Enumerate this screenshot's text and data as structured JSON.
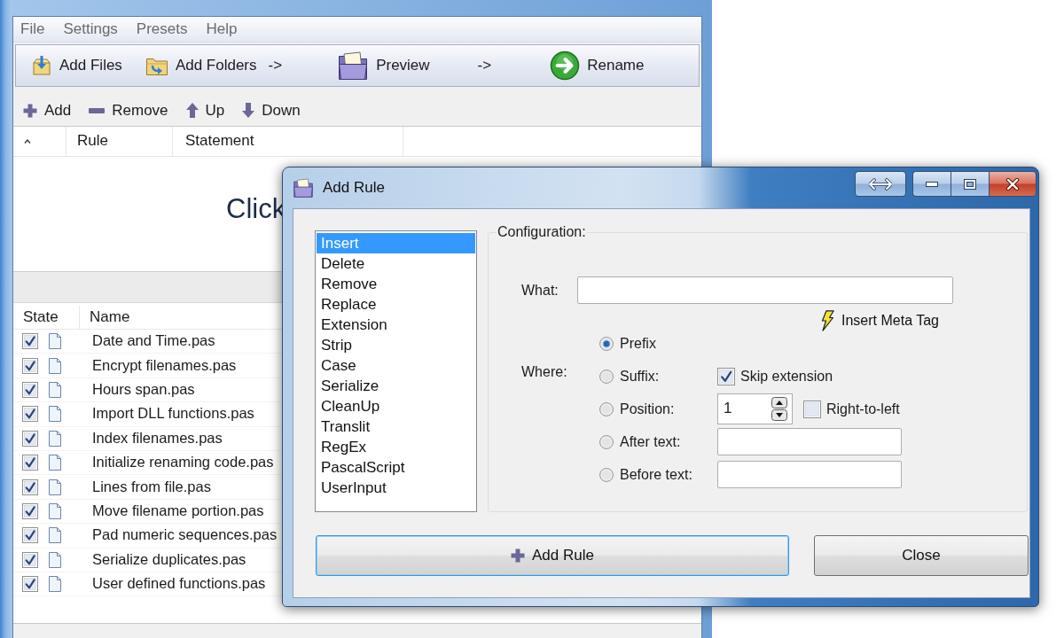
{
  "main_window": {
    "menu": [
      {
        "label": "File"
      },
      {
        "label": "Settings"
      },
      {
        "label": "Presets"
      },
      {
        "label": "Help"
      }
    ],
    "toolbar": [
      {
        "kind": "button",
        "label": "Add Files"
      },
      {
        "kind": "button",
        "label": "Add Folders"
      },
      {
        "kind": "arrow",
        "label": "->"
      },
      {
        "kind": "button",
        "label": "Preview"
      },
      {
        "kind": "arrow",
        "label": "->"
      },
      {
        "kind": "button",
        "label": "Rename"
      }
    ],
    "rules_toolbar": [
      {
        "label": "Add"
      },
      {
        "label": "Remove"
      },
      {
        "label": "Up"
      },
      {
        "label": "Down"
      }
    ],
    "rules_table": {
      "columns": [
        "Rule",
        "Statement"
      ],
      "hint": "Click"
    },
    "files_table": {
      "columns": [
        "State",
        "Name"
      ],
      "rows": [
        {
          "checked": true,
          "name": "Date and Time.pas"
        },
        {
          "checked": true,
          "name": "Encrypt filenames.pas"
        },
        {
          "checked": true,
          "name": "Hours span.pas"
        },
        {
          "checked": true,
          "name": "Import DLL functions.pas"
        },
        {
          "checked": true,
          "name": "Index filenames.pas"
        },
        {
          "checked": true,
          "name": "Initialize renaming code.pas"
        },
        {
          "checked": true,
          "name": "Lines from file.pas"
        },
        {
          "checked": true,
          "name": "Move filename portion.pas"
        },
        {
          "checked": true,
          "name": "Pad numeric sequences.pas"
        },
        {
          "checked": true,
          "name": "Serialize duplicates.pas"
        },
        {
          "checked": true,
          "name": "User defined functions.pas"
        }
      ]
    }
  },
  "dialog": {
    "title": "Add Rule",
    "rule_types": [
      {
        "label": "Insert",
        "selected": true
      },
      {
        "label": "Delete",
        "selected": false
      },
      {
        "label": "Remove",
        "selected": false
      },
      {
        "label": "Replace",
        "selected": false
      },
      {
        "label": "Extension",
        "selected": false
      },
      {
        "label": "Strip",
        "selected": false
      },
      {
        "label": "Case",
        "selected": false
      },
      {
        "label": "Serialize",
        "selected": false
      },
      {
        "label": "CleanUp",
        "selected": false
      },
      {
        "label": "Translit",
        "selected": false
      },
      {
        "label": "RegEx",
        "selected": false
      },
      {
        "label": "PascalScript",
        "selected": false
      },
      {
        "label": "UserInput",
        "selected": false
      }
    ],
    "configuration": {
      "title": "Configuration:",
      "what": {
        "label": "What:"
      },
      "meta_tag_link": "Insert Meta Tag",
      "where": {
        "label": "Where:",
        "options": [
          {
            "label": "Prefix",
            "selected": true
          },
          {
            "label": "Suffix:",
            "selected": false,
            "controls": [
              {
                "kind": "checkbox",
                "label": "Skip extension",
                "checked": true
              }
            ]
          },
          {
            "label": "Position:",
            "selected": false,
            "controls": [
              {
                "kind": "spin",
                "value": "1"
              },
              {
                "kind": "checkbox",
                "label": "Right-to-left",
                "checked": false
              }
            ]
          },
          {
            "label": "After text:",
            "selected": false,
            "controls": [
              {
                "kind": "text_field"
              }
            ]
          },
          {
            "label": "Before text:",
            "selected": false,
            "controls": [
              {
                "kind": "text_field"
              }
            ]
          }
        ]
      }
    },
    "buttons": [
      {
        "label": "Add Rule",
        "focused": true
      },
      {
        "label": "Close",
        "focused": false
      }
    ]
  }
}
